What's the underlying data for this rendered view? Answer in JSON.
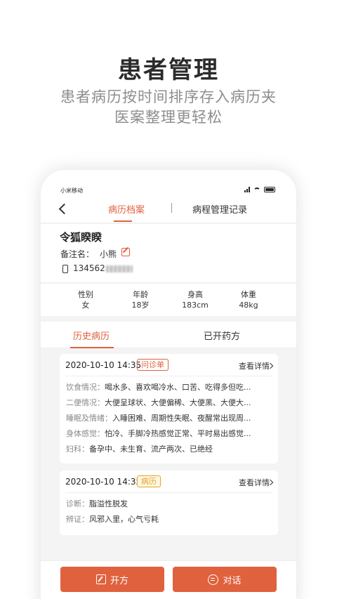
{
  "hero": {
    "title": "患者管理",
    "subtitle_line1": "患者病历按时间排序存入病历夹",
    "subtitle_line2": "医案整理更轻松"
  },
  "statusbar": {
    "carrier": "小米移动"
  },
  "nav": {
    "tab_active": "病历档案",
    "tab_other": "病程管理记录"
  },
  "patient": {
    "name": "令狐睽睽",
    "remark_label": "备注名：",
    "remark_value": "小熊",
    "phone_visible": "134562"
  },
  "stats": [
    {
      "label": "性别",
      "value": "女"
    },
    {
      "label": "年龄",
      "value": "18岁"
    },
    {
      "label": "身高",
      "value": "183cm"
    },
    {
      "label": "体重",
      "value": "48kg"
    }
  ],
  "tabs": {
    "active": "历史病历",
    "other": "已开药方"
  },
  "records": [
    {
      "datetime": "2020-10-10 14:35",
      "tag": "问诊单",
      "detail_link": "查看详情",
      "rows": [
        {
          "key": "饮食情况：",
          "value": "喝水多、喜欢喝冷水、口苦、吃得多但吃..."
        },
        {
          "key": "二便情况：",
          "value": "大便呈球状、大便偏稀、大便黑、大便大..."
        },
        {
          "key": "睡眠及情绪：",
          "value": "入睡困难、周期性失眠、夜醒常出现周..."
        },
        {
          "key": "身体感觉：",
          "value": "怕冷、手脚冷热感觉正常、平时易出感觉..."
        },
        {
          "key": "妇科：",
          "value": "备孕中、未生育、流产两次、已绝经"
        }
      ]
    },
    {
      "datetime": "2020-10-10 14:35",
      "tag": "病历",
      "detail_link": "查看详情",
      "rows": [
        {
          "key": "诊断：",
          "value": "脂溢性脱发"
        },
        {
          "key": "辨证：",
          "value": "风邪入里，心气亏耗"
        }
      ]
    }
  ],
  "actions": {
    "prescribe": "开方",
    "chat": "对话"
  },
  "colors": {
    "accent": "#e0613e",
    "tag_yellow": "#e4a623"
  }
}
